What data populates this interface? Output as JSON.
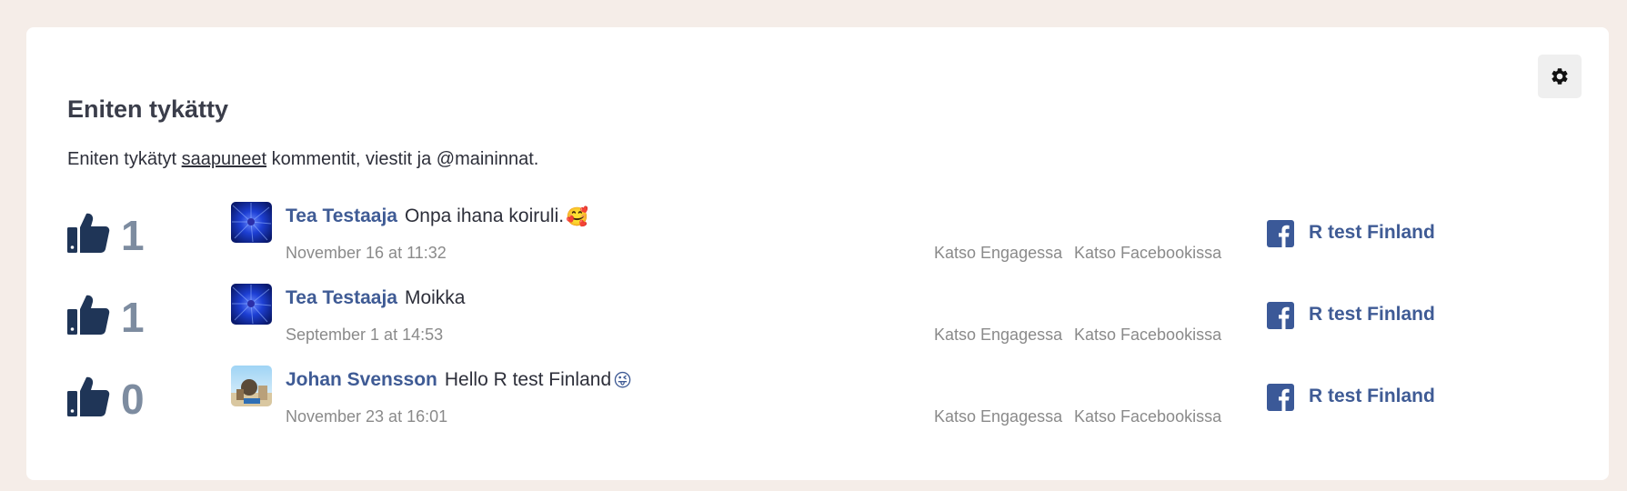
{
  "widget": {
    "title": "Eniten tykätty",
    "description_before": "Eniten tykätyt ",
    "description_link": "saapuneet",
    "description_after": " kommentit, viestit ja @maininnat."
  },
  "items": [
    {
      "likes": "1",
      "author": "Tea Testaaja",
      "message": "Onpa ihana koiruli.",
      "emoji": "🥰",
      "date": "November 16 at 11:32",
      "action_engage": "Katso Engagessa",
      "action_facebook": "Katso Facebookissa",
      "page": "R test Finland"
    },
    {
      "likes": "1",
      "author": "Tea Testaaja",
      "message": "Moikka",
      "emoji": "",
      "date": "September 1 at 14:53",
      "action_engage": "Katso Engagessa",
      "action_facebook": "Katso Facebookissa",
      "page": "R test Finland"
    },
    {
      "likes": "0",
      "author": "Johan Svensson",
      "message": "Hello R test Finland",
      "emoji": "😜",
      "date": "November 23 at 16:01",
      "action_engage": "Katso Engagessa",
      "action_facebook": "Katso Facebookissa",
      "page": "R test Finland"
    }
  ],
  "icons": {
    "settings": "gear-icon",
    "like": "thumbs-up-icon",
    "platform": "facebook-icon"
  },
  "colors": {
    "background": "#f5ede8",
    "card": "#ffffff",
    "accent_link": "#3f5b95",
    "like_icon": "#1f3557",
    "like_count": "#7d8ca0",
    "facebook": "#3b5998"
  }
}
